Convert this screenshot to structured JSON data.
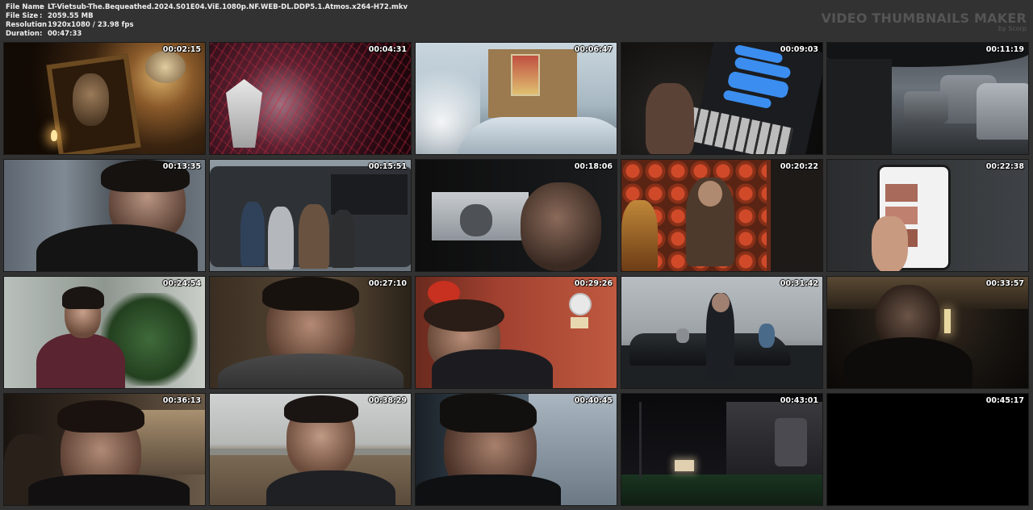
{
  "info": {
    "rows": [
      {
        "label": "File Name",
        "sep": ":",
        "value": "LT-Vietsub-The.Bequeathed.2024.S01E04.ViE.1080p.NF.WEB-DL.DDP5.1.Atmos.x264-H72.mkv"
      },
      {
        "label": "File Size",
        "sep": ":",
        "value": "2059.55 MB"
      },
      {
        "label": "Resolution",
        "sep": ":",
        "value": "1920x1080 / 23.98 fps"
      },
      {
        "label": "Duration",
        "sep": ":",
        "value": "00:47:33"
      }
    ]
  },
  "brand": {
    "title": "VIDEO THUMBNAILS MAKER",
    "subtitle": "by Scorp"
  },
  "thumbnails": [
    {
      "time": "00:02:15"
    },
    {
      "time": "00:04:31"
    },
    {
      "time": "00:06:47"
    },
    {
      "time": "00:09:03"
    },
    {
      "time": "00:11:19"
    },
    {
      "time": "00:13:35"
    },
    {
      "time": "00:15:51"
    },
    {
      "time": "00:18:06"
    },
    {
      "time": "00:20:22"
    },
    {
      "time": "00:22:38"
    },
    {
      "time": "00:24:54"
    },
    {
      "time": "00:27:10"
    },
    {
      "time": "00:29:26"
    },
    {
      "time": "00:31:42"
    },
    {
      "time": "00:33:57"
    },
    {
      "time": "00:36:13"
    },
    {
      "time": "00:38:29"
    },
    {
      "time": "00:40:45"
    },
    {
      "time": "00:43:01"
    },
    {
      "time": "00:45:17"
    }
  ]
}
